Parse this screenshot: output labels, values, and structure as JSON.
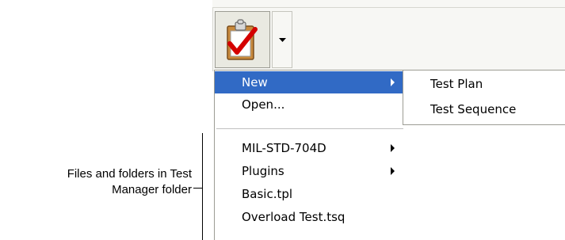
{
  "toolbar": {
    "main_button_icon": "clipboard-checkmark-icon",
    "dropdown_icon": "chevron-down-icon"
  },
  "menu": {
    "items": [
      {
        "label": "New",
        "has_submenu": true,
        "highlighted": true
      },
      {
        "label": "Open...",
        "has_submenu": false,
        "highlighted": false
      },
      {
        "label": "MIL-STD-704D",
        "has_submenu": true,
        "highlighted": false
      },
      {
        "label": "Plugins",
        "has_submenu": true,
        "highlighted": false
      },
      {
        "label": "Basic.tpl",
        "has_submenu": false,
        "highlighted": false
      },
      {
        "label": "Overload Test.tsq",
        "has_submenu": false,
        "highlighted": false
      }
    ],
    "highlight_color": "#316ac5"
  },
  "submenu": {
    "items": [
      {
        "label": "Test Plan"
      },
      {
        "label": "Test Sequence"
      }
    ]
  },
  "annotation": {
    "line1": "Files and folders in Test",
    "line2": "Manager folder"
  }
}
